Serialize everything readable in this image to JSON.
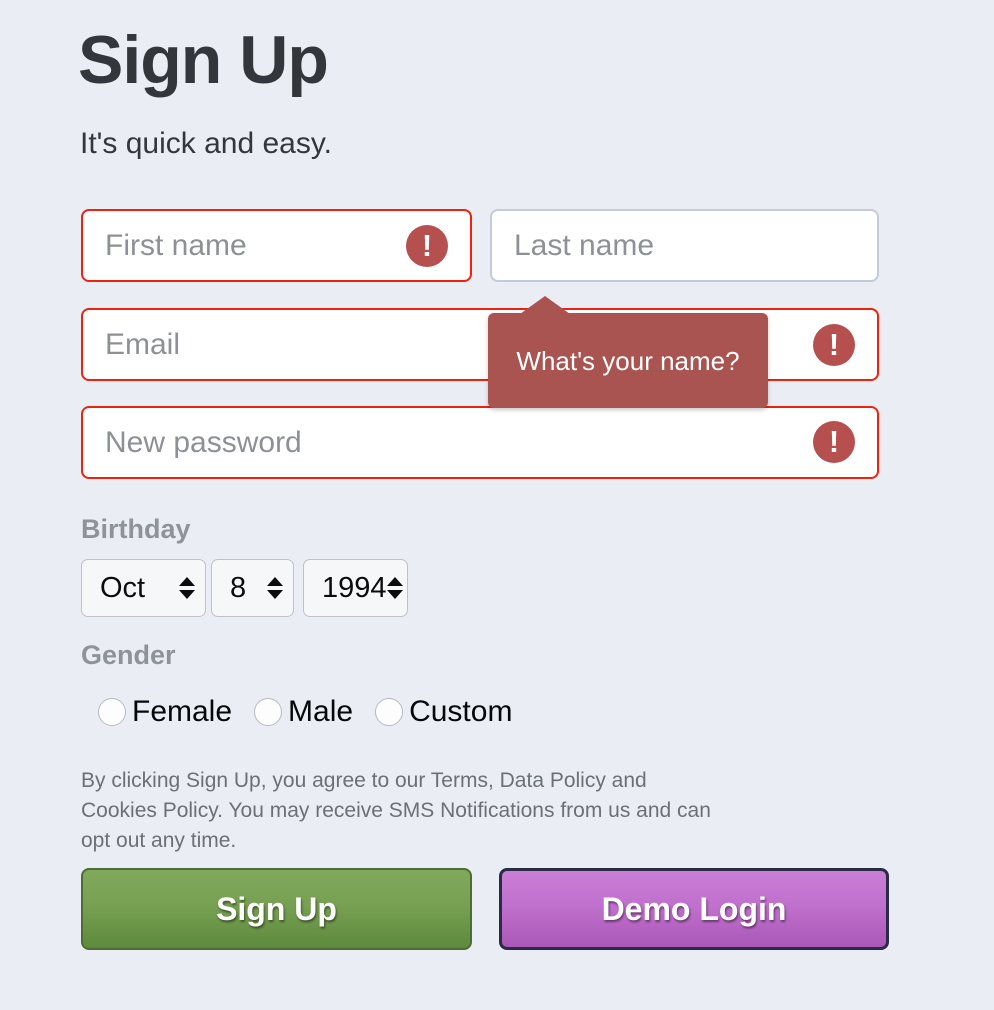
{
  "page": {
    "background_color": "#eaeef4",
    "title": "Sign Up",
    "subtitle": "It's quick and easy."
  },
  "form": {
    "fields": [
      {
        "name": "first_name",
        "placeholder": "First name",
        "value": "",
        "error": true,
        "error_icon": "exclamation-circle-icon"
      },
      {
        "name": "last_name",
        "placeholder": "Last name",
        "value": "",
        "error": false
      },
      {
        "name": "email",
        "placeholder": "Email",
        "value": "",
        "error": true,
        "error_icon": "exclamation-circle-icon"
      },
      {
        "name": "new_password",
        "placeholder": "New password",
        "value": "",
        "error": true,
        "error_icon": "exclamation-circle-icon"
      }
    ],
    "tooltip": {
      "text": "What's your name?",
      "background_color": "#a95450",
      "text_color": "#ffffff"
    },
    "birthday": {
      "label": "Birthday",
      "month": "Oct",
      "day": "8",
      "year": "1994"
    },
    "gender": {
      "label": "Gender",
      "options": [
        {
          "label": "Female",
          "selected": false
        },
        {
          "label": "Male",
          "selected": false
        },
        {
          "label": "Custom",
          "selected": false
        }
      ]
    },
    "terms": "By clicking Sign Up, you agree to our Terms, Data Policy and Cookies Policy. You may receive SMS Notifications from us and can opt out any time.",
    "buttons": {
      "signup": {
        "label": "Sign Up",
        "color": "#77a052"
      },
      "demo_login": {
        "label": "Demo Login",
        "color": "#c070cd"
      }
    }
  },
  "colors": {
    "error_border": "#ee2211",
    "error_icon": "#b5504e",
    "field_border": "#c3cbd8",
    "label_text": "#8e939b",
    "placeholder_text": "#8d9095"
  }
}
